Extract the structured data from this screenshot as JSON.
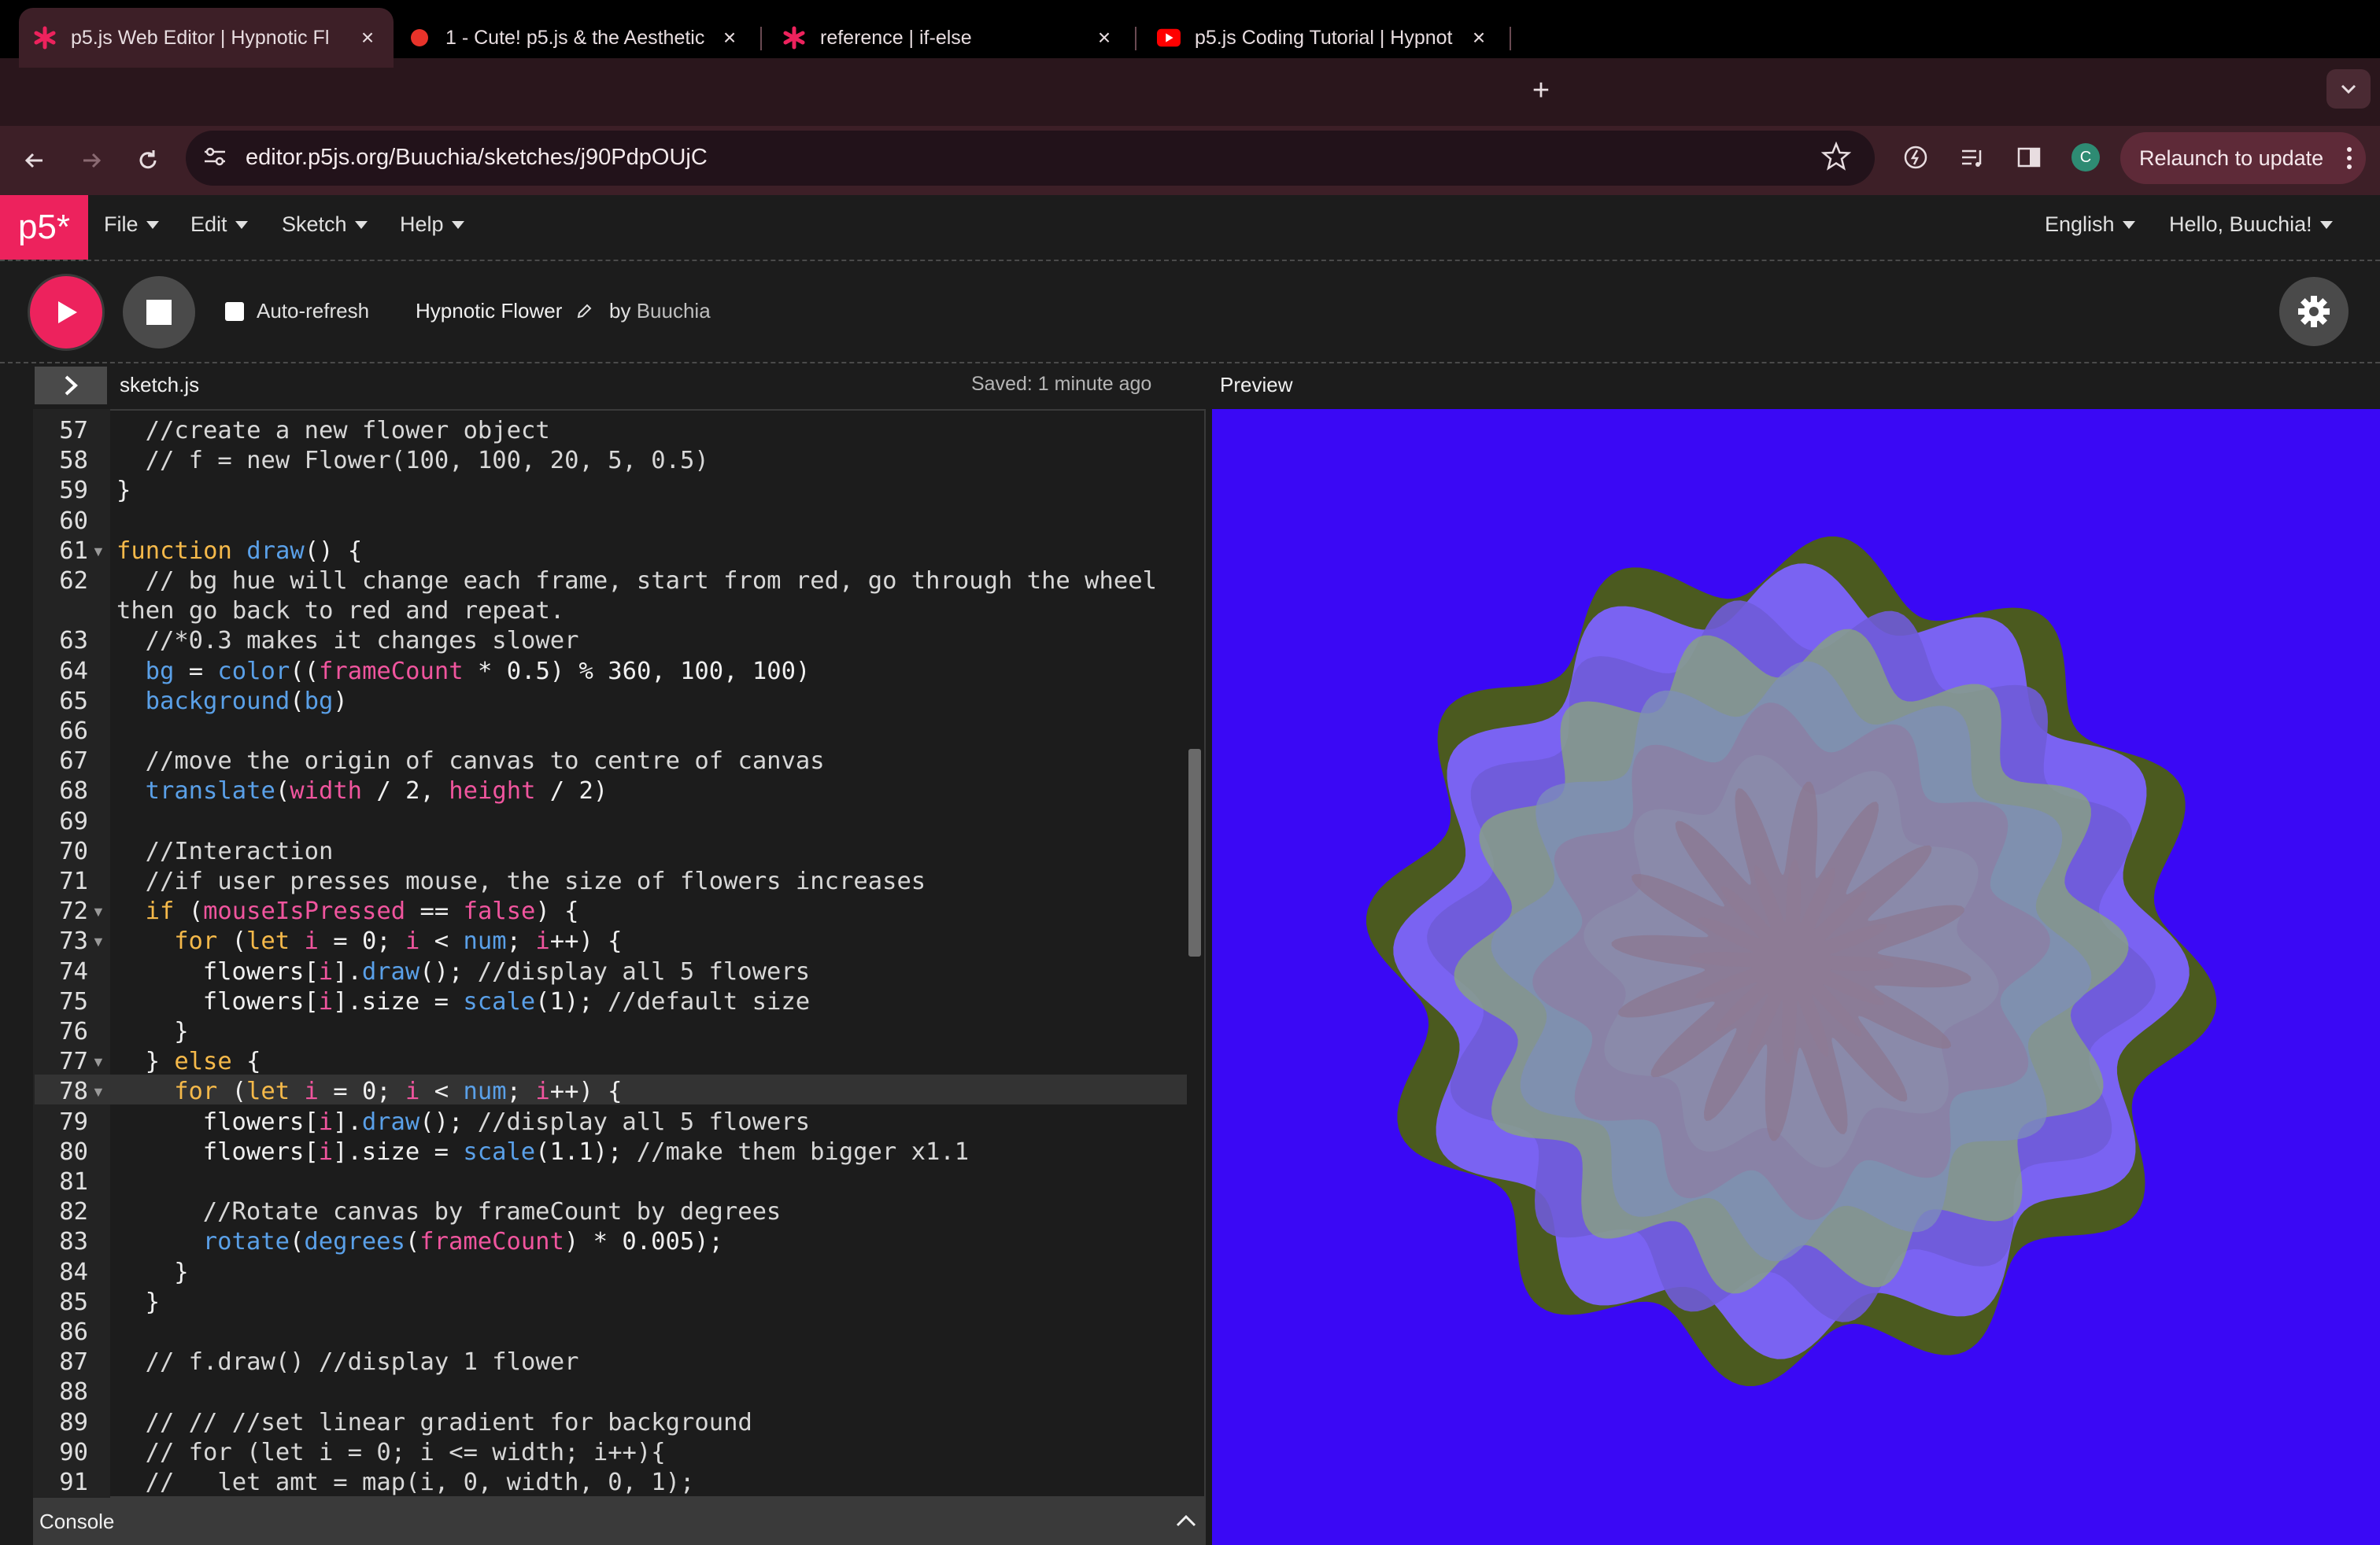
{
  "browser": {
    "tabs": [
      {
        "label": "p5.js Web Editor | Hypnotic Fl",
        "icon": "p5-asterisk-icon",
        "active": true
      },
      {
        "label": "1 - Cute! p5.js & the Aesthetic",
        "icon": "red-bug-icon",
        "active": false
      },
      {
        "label": "reference | if-else",
        "icon": "p5-asterisk-icon",
        "active": false
      },
      {
        "label": "p5.js Coding Tutorial | Hypnot",
        "icon": "youtube-icon",
        "active": false
      }
    ],
    "close_glyph": "×",
    "new_tab_glyph": "+",
    "url": "editor.p5js.org/Buuchia/sketches/j90PdpOUjC",
    "profile_initial": "C",
    "relaunch_label": "Relaunch to update",
    "colors": {
      "tabbar": "#2a161c",
      "addrbar": "#3d1f27",
      "relaunch": "#5e2a38"
    }
  },
  "editor": {
    "logo": "p5*",
    "menus": [
      "File",
      "Edit",
      "Sketch",
      "Help"
    ],
    "language": "English",
    "greeting": "Hello, Buuchia!",
    "auto_refresh_label": "Auto-refresh",
    "auto_refresh_checked": false,
    "sketch_name": "Hypnotic Flower",
    "by_label": "by",
    "owner": "Buuchia",
    "file_name": "sketch.js",
    "saved_status": "Saved: 1 minute ago",
    "preview_label": "Preview",
    "console_label": "Console",
    "accent": "#ed225d",
    "preview_bg": "#3a08f5"
  },
  "code": {
    "highlighted_line": 78,
    "lines": [
      {
        "n": "57",
        "fold": false,
        "indent": 1,
        "text": "//create a new flower object"
      },
      {
        "n": "58",
        "fold": false,
        "indent": 1,
        "text": "// f = new Flower(100, 100, 20, 5, 0.5)"
      },
      {
        "n": "59",
        "fold": false,
        "indent": 0,
        "text": "}"
      },
      {
        "n": "60",
        "fold": false,
        "indent": 0,
        "text": ""
      },
      {
        "n": "61",
        "fold": true,
        "indent": 0,
        "text": "function draw() {"
      },
      {
        "n": "62",
        "fold": false,
        "indent": 1,
        "text": "// bg hue will change each frame, start from red, go through the wheel"
      },
      {
        "n": "",
        "fold": false,
        "indent": 0,
        "text": "then go back to red and repeat."
      },
      {
        "n": "63",
        "fold": false,
        "indent": 1,
        "text": "//*0.3 makes it changes slower"
      },
      {
        "n": "64",
        "fold": false,
        "indent": 1,
        "text": "bg = color((frameCount * 0.5) % 360, 100, 100)"
      },
      {
        "n": "65",
        "fold": false,
        "indent": 1,
        "text": "background(bg)"
      },
      {
        "n": "66",
        "fold": false,
        "indent": 0,
        "text": ""
      },
      {
        "n": "67",
        "fold": false,
        "indent": 1,
        "text": "//move the origin of canvas to centre of canvas"
      },
      {
        "n": "68",
        "fold": false,
        "indent": 1,
        "text": "translate(width / 2, height / 2)"
      },
      {
        "n": "69",
        "fold": false,
        "indent": 0,
        "text": ""
      },
      {
        "n": "70",
        "fold": false,
        "indent": 1,
        "text": "//Interaction"
      },
      {
        "n": "71",
        "fold": false,
        "indent": 1,
        "text": "//if user presses mouse, the size of flowers increases"
      },
      {
        "n": "72",
        "fold": true,
        "indent": 1,
        "text": "if (mouseIsPressed == false) {"
      },
      {
        "n": "73",
        "fold": true,
        "indent": 2,
        "text": "for (let i = 0; i < num; i++) {"
      },
      {
        "n": "74",
        "fold": false,
        "indent": 3,
        "text": "flowers[i].draw(); //display all 5 flowers"
      },
      {
        "n": "75",
        "fold": false,
        "indent": 3,
        "text": "flowers[i].size = scale(1); //default size"
      },
      {
        "n": "76",
        "fold": false,
        "indent": 2,
        "text": "}"
      },
      {
        "n": "77",
        "fold": true,
        "indent": 1,
        "text": "} else {"
      },
      {
        "n": "78",
        "fold": true,
        "indent": 2,
        "text": "for (let i = 0; i < num; i++) {"
      },
      {
        "n": "79",
        "fold": false,
        "indent": 3,
        "text": "flowers[i].draw(); //display all 5 flowers"
      },
      {
        "n": "80",
        "fold": false,
        "indent": 3,
        "text": "flowers[i].size = scale(1.1); //make them bigger x1.1"
      },
      {
        "n": "81",
        "fold": false,
        "indent": 0,
        "text": ""
      },
      {
        "n": "82",
        "fold": false,
        "indent": 3,
        "text": "//Rotate canvas by frameCount by degrees"
      },
      {
        "n": "83",
        "fold": false,
        "indent": 3,
        "text": "rotate(degrees(frameCount) * 0.005);"
      },
      {
        "n": "84",
        "fold": false,
        "indent": 2,
        "text": "}"
      },
      {
        "n": "85",
        "fold": false,
        "indent": 1,
        "text": "}"
      },
      {
        "n": "86",
        "fold": false,
        "indent": 0,
        "text": ""
      },
      {
        "n": "87",
        "fold": false,
        "indent": 1,
        "text": "// f.draw() //display 1 flower"
      },
      {
        "n": "88",
        "fold": false,
        "indent": 0,
        "text": ""
      },
      {
        "n": "89",
        "fold": false,
        "indent": 1,
        "text": "// // //set linear gradient for background"
      },
      {
        "n": "90",
        "fold": false,
        "indent": 1,
        "text": "// for (let i = 0; i <= width; i++){"
      },
      {
        "n": "91",
        "fold": false,
        "indent": 1,
        "text": "//   let amt = map(i, 0, width, 0, 1);"
      }
    ]
  }
}
